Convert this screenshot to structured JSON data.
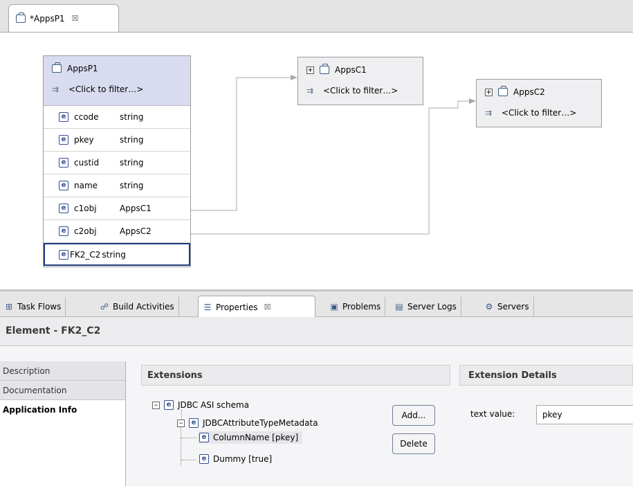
{
  "editor": {
    "tab_label": "*AppsP1",
    "tab_close": "☒",
    "nodes": {
      "main": {
        "title": "AppsP1",
        "filter": "<Click to filter…>",
        "attributes": [
          {
            "name": "ccode",
            "type": "string"
          },
          {
            "name": "pkey",
            "type": "string"
          },
          {
            "name": "custid",
            "type": "string"
          },
          {
            "name": "name",
            "type": "string"
          },
          {
            "name": "c1obj",
            "type": "AppsC1"
          },
          {
            "name": "c2obj",
            "type": "AppsC2"
          },
          {
            "name": "FK2_C2",
            "type": "string"
          }
        ]
      },
      "c1": {
        "title": "AppsC1",
        "filter": "<Click to filter…>"
      },
      "c2": {
        "title": "AppsC2",
        "filter": "<Click to filter…>"
      }
    }
  },
  "views": {
    "tabs": [
      {
        "label": "Task Flows",
        "icon": "task-flows-icon"
      },
      {
        "label": "Build Activities",
        "icon": "build-activities-icon"
      },
      {
        "label": "Properties",
        "icon": "properties-icon",
        "active": true,
        "close": "☒"
      },
      {
        "label": "Problems",
        "icon": "problems-icon"
      },
      {
        "label": "Server Logs",
        "icon": "server-logs-icon"
      },
      {
        "label": "Servers",
        "icon": "servers-icon"
      }
    ]
  },
  "properties": {
    "title": "Element - FK2_C2",
    "side_tabs": [
      "Description",
      "Documentation",
      "Application Info"
    ],
    "extensions_header": "Extensions",
    "extension_details_header": "Extension Details",
    "tree": [
      {
        "label": "JDBC ASI schema"
      },
      {
        "label": "JDBCAttributeTypeMetadata"
      },
      {
        "label": "ColumnName [pkey]"
      },
      {
        "label": "Dummy [true]"
      }
    ],
    "add_label": "Add...",
    "delete_label": "Delete",
    "text_value_label": "text value:",
    "text_value": "pkey"
  }
}
